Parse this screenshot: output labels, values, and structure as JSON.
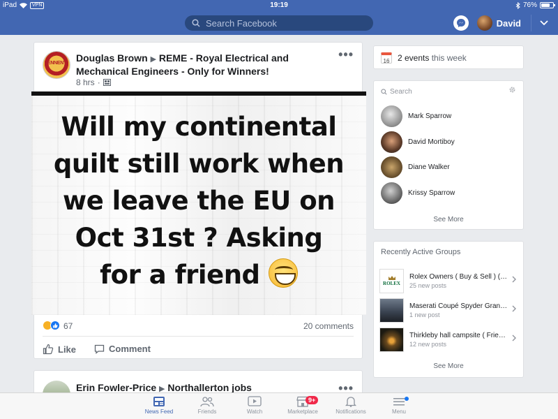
{
  "status_bar": {
    "device": "iPad",
    "vpn": "VPN",
    "time": "19:19",
    "battery": "76%",
    "battery_level": 0.76
  },
  "nav": {
    "search_placeholder": "Search Facebook",
    "user_name": "David",
    "colors": {
      "brand": "#4267b2"
    }
  },
  "post1": {
    "author": "Douglas Brown",
    "group": "REME - Royal Electrical and Mechanical Engineers - Only for Winners!",
    "time": "8 hrs",
    "avatar_text": "TENNENT",
    "image_text": [
      "Will my continental",
      "quilt still work when",
      "we leave the EU on",
      "Oct 31st ? Asking",
      "for a friend"
    ],
    "reaction_count": "67",
    "comments": "20 comments",
    "like_label": "Like",
    "comment_label": "Comment"
  },
  "post2": {
    "author": "Erin Fowler-Price",
    "group": "Northallerton jobs"
  },
  "events": {
    "count_text": "2 events",
    "suffix": "this week",
    "calendar_day": "16"
  },
  "contacts": {
    "search_placeholder": "Search",
    "items": [
      {
        "name": "Mark Sparrow"
      },
      {
        "name": "David Mortiboy"
      },
      {
        "name": "Diane Walker"
      },
      {
        "name": "Krissy Sparrow"
      }
    ],
    "see_more": "See More"
  },
  "groups": {
    "heading": "Recently Active Groups",
    "items": [
      {
        "name": "Rolex Owners  ( Buy & Sell ) (…",
        "sub": "25 new posts",
        "thumb_text": "ROLEX"
      },
      {
        "name": "Maserati Coupé Spyder Gran…",
        "sub": "1 new post"
      },
      {
        "name": "Thirkleby hall campsite ( Frie…",
        "sub": "12 new posts"
      }
    ],
    "see_more": "See More"
  },
  "tabs": [
    {
      "label": "News Feed"
    },
    {
      "label": "Friends"
    },
    {
      "label": "Watch"
    },
    {
      "label": "Marketplace",
      "badge": "9+"
    },
    {
      "label": "Notifications"
    },
    {
      "label": "Menu"
    }
  ]
}
